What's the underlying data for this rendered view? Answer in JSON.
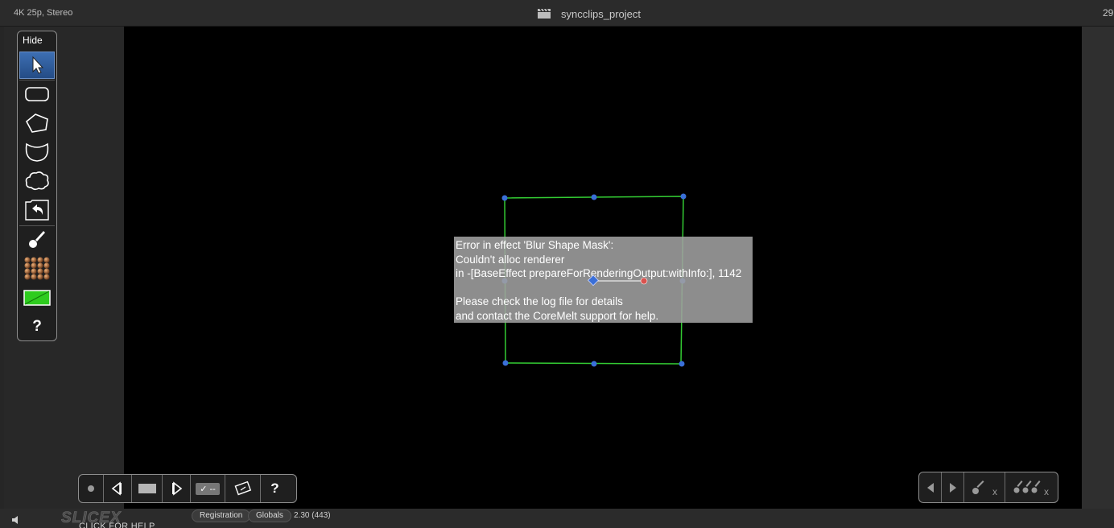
{
  "window": {
    "format_info": "4K 25p, Stereo",
    "project_title": "syncclips_project",
    "cut_number": "29"
  },
  "tool_palette": {
    "hide_label": "Hide",
    "tools": [
      "select-arrow-icon",
      "rounded-rect-icon",
      "polygon-icon",
      "bezier-shape-icon",
      "cloud-shape-icon",
      "undo-icon",
      "paint-brush-icon",
      "texture-grid-icon",
      "color-swatch-icon",
      "help-icon"
    ],
    "swatch_color": "#2ecc1e",
    "help_label": "?"
  },
  "mask": {
    "outline_color": "#33cc33",
    "handle_color": "#3a6fd8",
    "angle_handle_color": "#d9534f"
  },
  "error": {
    "lines": [
      "Error in effect 'Blur Shape Mask':",
      "Couldn't alloc renderer",
      "in -[BaseEffect prepareForRenderingOutput:withInfo:], 1142",
      "",
      "Please check the log file for details",
      "and contact the CoreMelt support for help."
    ]
  },
  "transport": {
    "buttons": [
      "record-dot-icon",
      "step-back-icon",
      "frame-rect-icon",
      "step-forward-icon",
      "checkmark-toggle-icon",
      "rotate-frame-icon",
      "help-icon"
    ],
    "check_label": "✓ --",
    "help_label": "?"
  },
  "nav": {
    "buttons": [
      "prev-arrow-icon",
      "next-arrow-icon",
      "delete-brush-icon",
      "delete-all-brushes-icon"
    ],
    "x_label": "x"
  },
  "footer": {
    "logo_text": "SLICEX",
    "click_for_help": "CLICK FOR HELP",
    "registration_label": "Registration",
    "globals_label": "Globals",
    "version": "2.30 (443)"
  }
}
